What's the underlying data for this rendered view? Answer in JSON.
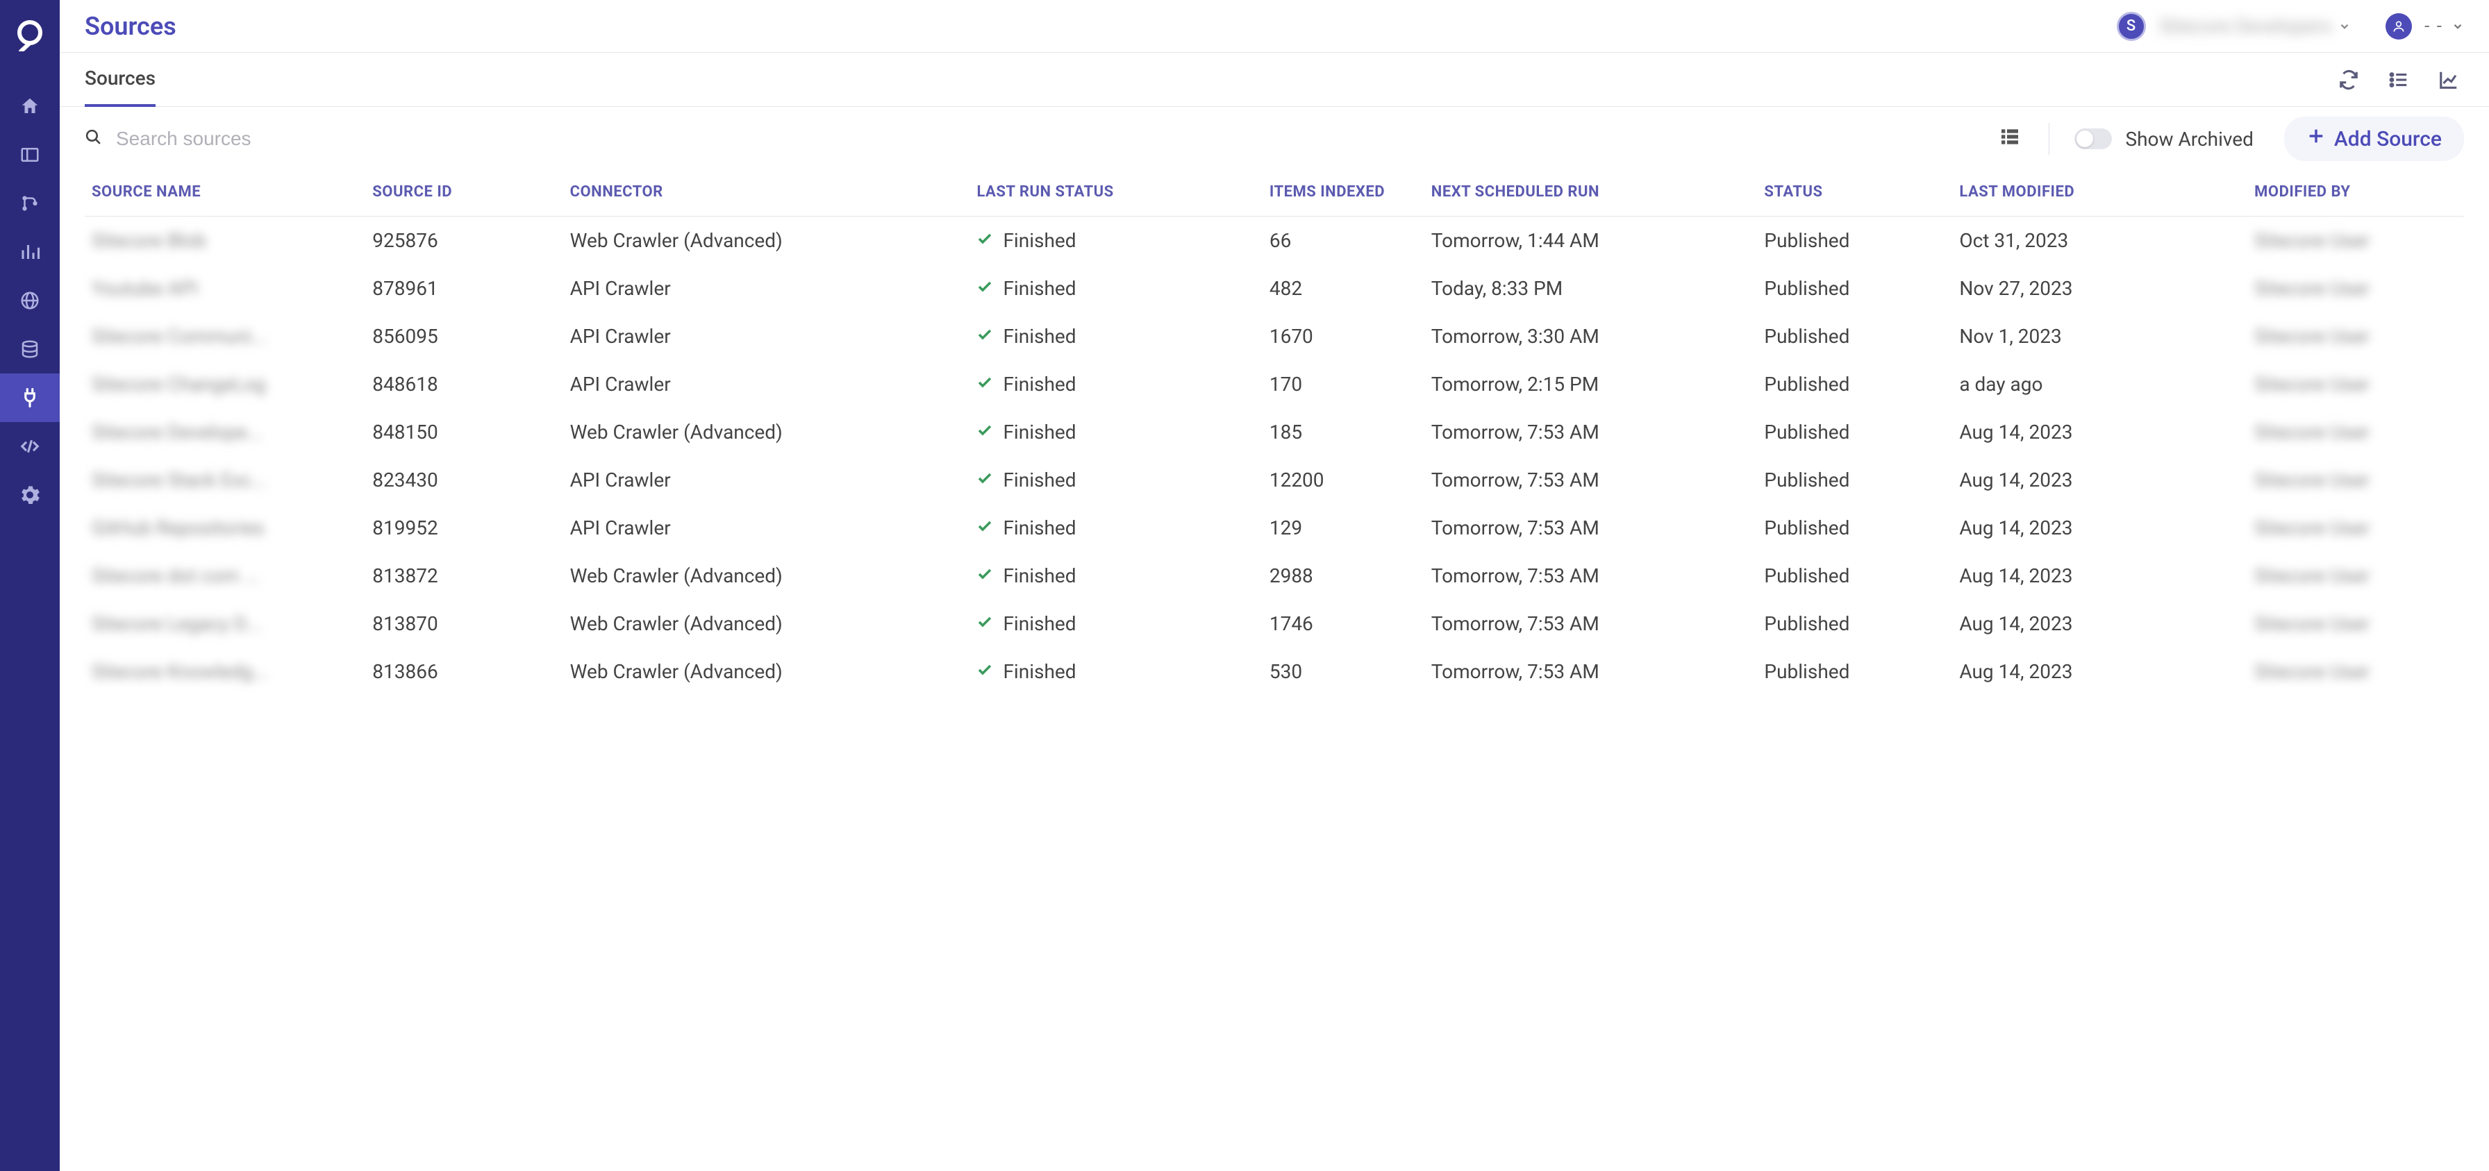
{
  "header": {
    "title": "Sources",
    "orgInitial": "S",
    "orgName": "Sitecore Developers",
    "userName": "- -"
  },
  "tabs": {
    "sources": "Sources"
  },
  "toolbar": {
    "searchPlaceholder": "Search sources",
    "showArchived": "Show Archived",
    "addSource": "Add Source"
  },
  "columns": {
    "name": "SOURCE NAME",
    "id": "SOURCE ID",
    "connector": "CONNECTOR",
    "lastRun": "LAST RUN STATUS",
    "indexed": "ITEMS INDEXED",
    "next": "NEXT SCHEDULED RUN",
    "status": "STATUS",
    "modified": "LAST MODIFIED",
    "by": "MODIFIED BY"
  },
  "rows": [
    {
      "name": "Sitecore Blob",
      "id": "925876",
      "connector": "Web Crawler (Advanced)",
      "lastRun": "Finished",
      "indexed": "66",
      "next": "Tomorrow, 1:44 AM",
      "status": "Published",
      "modified": "Oct 31, 2023",
      "by": "Sitecore User"
    },
    {
      "name": "Youtube API",
      "id": "878961",
      "connector": "API Crawler",
      "lastRun": "Finished",
      "indexed": "482",
      "next": "Today, 8:33 PM",
      "status": "Published",
      "modified": "Nov 27, 2023",
      "by": "Sitecore User"
    },
    {
      "name": "Sitecore Communi...",
      "id": "856095",
      "connector": "API Crawler",
      "lastRun": "Finished",
      "indexed": "1670",
      "next": "Tomorrow, 3:30 AM",
      "status": "Published",
      "modified": "Nov 1, 2023",
      "by": "Sitecore User"
    },
    {
      "name": "Sitecore ChangeLog",
      "id": "848618",
      "connector": "API Crawler",
      "lastRun": "Finished",
      "indexed": "170",
      "next": "Tomorrow, 2:15 PM",
      "status": "Published",
      "modified": "a day ago",
      "by": "Sitecore User"
    },
    {
      "name": "Sitecore Develope...",
      "id": "848150",
      "connector": "Web Crawler (Advanced)",
      "lastRun": "Finished",
      "indexed": "185",
      "next": "Tomorrow, 7:53 AM",
      "status": "Published",
      "modified": "Aug 14, 2023",
      "by": "Sitecore User"
    },
    {
      "name": "Sitecore Stack Exc...",
      "id": "823430",
      "connector": "API Crawler",
      "lastRun": "Finished",
      "indexed": "12200",
      "next": "Tomorrow, 7:53 AM",
      "status": "Published",
      "modified": "Aug 14, 2023",
      "by": "Sitecore User"
    },
    {
      "name": "GitHub Repositories",
      "id": "819952",
      "connector": "API Crawler",
      "lastRun": "Finished",
      "indexed": "129",
      "next": "Tomorrow, 7:53 AM",
      "status": "Published",
      "modified": "Aug 14, 2023",
      "by": "Sitecore User"
    },
    {
      "name": "Sitecore dot com ...",
      "id": "813872",
      "connector": "Web Crawler (Advanced)",
      "lastRun": "Finished",
      "indexed": "2988",
      "next": "Tomorrow, 7:53 AM",
      "status": "Published",
      "modified": "Aug 14, 2023",
      "by": "Sitecore User"
    },
    {
      "name": "Sitecore Legacy D...",
      "id": "813870",
      "connector": "Web Crawler (Advanced)",
      "lastRun": "Finished",
      "indexed": "1746",
      "next": "Tomorrow, 7:53 AM",
      "status": "Published",
      "modified": "Aug 14, 2023",
      "by": "Sitecore User"
    },
    {
      "name": "Sitecore Knowledg...",
      "id": "813866",
      "connector": "Web Crawler (Advanced)",
      "lastRun": "Finished",
      "indexed": "530",
      "next": "Tomorrow, 7:53 AM",
      "status": "Published",
      "modified": "Aug 14, 2023",
      "by": "Sitecore User"
    }
  ]
}
